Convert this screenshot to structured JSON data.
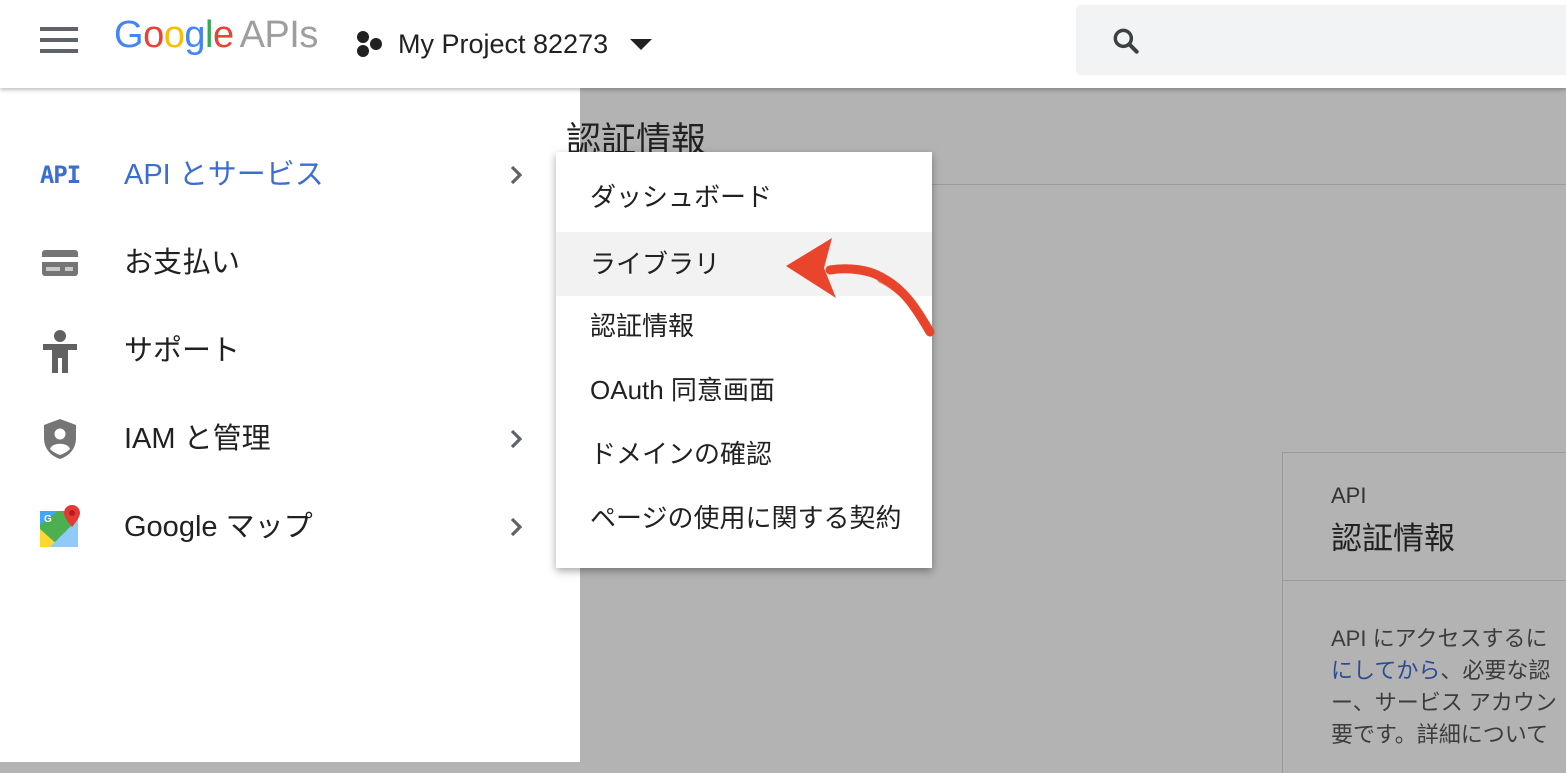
{
  "header": {
    "logo_google": "Google",
    "logo_apis": "APIs",
    "project_name": "My Project 82273"
  },
  "sidebar": {
    "items": [
      {
        "label": "API とサービス",
        "icon": "api-icon",
        "active": true,
        "has_chevron": true
      },
      {
        "label": "お支払い",
        "icon": "billing-card-icon",
        "has_chevron": false
      },
      {
        "label": "サポート",
        "icon": "support-person-icon",
        "has_chevron": false
      },
      {
        "label": "IAM と管理",
        "icon": "shield-user-icon",
        "has_chevron": true
      },
      {
        "label": "Google マップ",
        "icon": "google-maps-icon",
        "has_chevron": true
      }
    ],
    "api_icon_text": "API"
  },
  "submenu": {
    "items": [
      {
        "label": "ダッシュボード"
      },
      {
        "label": "ライブラリ",
        "highlighted": true
      },
      {
        "label": "認証情報"
      },
      {
        "label": "OAuth 同意画面"
      },
      {
        "label": "ドメインの確認"
      },
      {
        "label": "ページの使用に関する契約"
      }
    ]
  },
  "main": {
    "page_title": "認証情報",
    "card": {
      "small_label": "API",
      "title": "認証情報",
      "body_line1": "API にアクセスするに",
      "body_link": "にしてから",
      "body_line2_rest": "、必要な認",
      "body_line3": "ー、サービス アカウン",
      "body_line4": "要です。詳細について"
    }
  },
  "colors": {
    "accent_blue": "#3b6ed1",
    "annotation_arrow": "#e8452c",
    "overlay": "#b3b3b3"
  }
}
